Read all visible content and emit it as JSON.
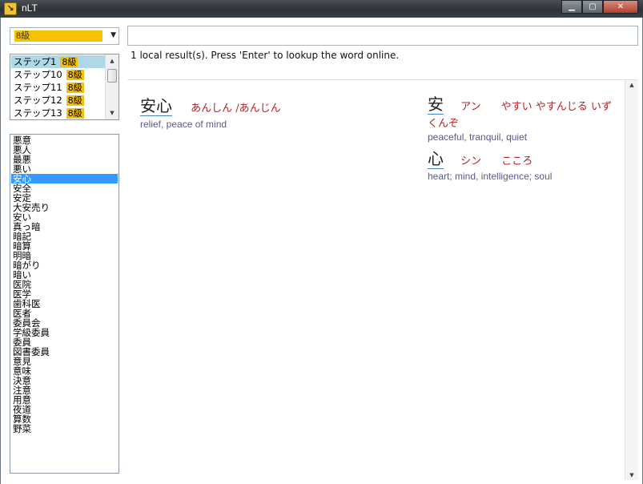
{
  "window": {
    "title": "nLT",
    "app_icon": "app-logo-icon"
  },
  "level_select": {
    "value": "8級"
  },
  "search": {
    "value": "",
    "placeholder": ""
  },
  "status": "1 local result(s). Press 'Enter' to lookup the word online.",
  "steps": [
    {
      "label": "ステップ1",
      "badge": "8級",
      "selected": true
    },
    {
      "label": "ステップ10",
      "badge": "8級",
      "selected": false
    },
    {
      "label": "ステップ11",
      "badge": "8級",
      "selected": false
    },
    {
      "label": "ステップ12",
      "badge": "8級",
      "selected": false
    },
    {
      "label": "ステップ13",
      "badge": "8級",
      "selected": false
    }
  ],
  "words": [
    "悪意",
    "悪人",
    "最悪",
    "悪い",
    "安心",
    "安全",
    "安定",
    "大安売り",
    "安い",
    "真っ暗",
    "暗記",
    "暗算",
    "明暗",
    "暗がり",
    "暗い",
    "医院",
    "医学",
    "歯科医",
    "医者",
    "委員会",
    "学級委員",
    "委員",
    "図書委員",
    "意見",
    "意味",
    "決意",
    "注意",
    "用意",
    "夜道",
    "算数",
    "野菜"
  ],
  "selected_word_index": 4,
  "result": {
    "word": "安心",
    "reading": "あんしん /あんじん",
    "meaning": "relief, peace of mind",
    "kanji": [
      {
        "char": "安",
        "on": "アン",
        "kun": "やすい やすんじる いずくんぞ",
        "meaning": "peaceful, tranquil, quiet"
      },
      {
        "char": "心",
        "on": "シン",
        "kun": "こころ",
        "meaning": "heart; mind, intelligence; soul"
      }
    ]
  },
  "colors": {
    "level_badge": "#f5c200",
    "selected_step": "#aed8e6",
    "selected_word": "#3399ff",
    "reading": "#b22222",
    "meaning": "#5a5a8a"
  }
}
